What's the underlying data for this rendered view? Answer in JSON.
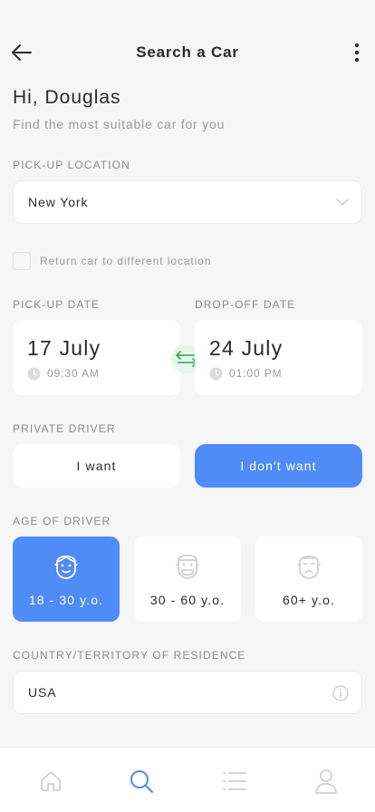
{
  "header": {
    "title": "Search a Car",
    "back_icon": "arrow-left-icon",
    "more_icon": "more-vertical-icon"
  },
  "greeting": {
    "title": "Hi, Douglas",
    "subtitle": "Find the most suitable car for you"
  },
  "pickup_location": {
    "label": "PICK-UP LOCATION",
    "value": "New York",
    "icon": "chevron-down-icon"
  },
  "return_different": {
    "label": "Return car to different location",
    "checked": false
  },
  "dates": {
    "pickup": {
      "label": "PICK-UP DATE",
      "date": "17 July",
      "time": "09:30 AM"
    },
    "dropoff": {
      "label": "DROP-OFF DATE",
      "date": "24 July",
      "time": "01:00 PM"
    },
    "swap_icon": "swap-arrows-icon"
  },
  "private_driver": {
    "label": "PRIVATE DRIVER",
    "options": [
      "I want",
      "I don't want"
    ],
    "selected": "I don't want"
  },
  "driver_age": {
    "label": "AGE OF DRIVER",
    "options": [
      "18 - 30 y.o.",
      "30 - 60 y.o.",
      "60+ y.o."
    ],
    "selected": "18 - 30 y.o."
  },
  "residence": {
    "label": "COUNTRY/TERRITORY OF RESIDENCE",
    "value": "USA",
    "icon": "info-icon"
  },
  "bottom_nav": {
    "items": [
      "home-icon",
      "search-icon",
      "list-icon",
      "profile-icon"
    ],
    "active": "search-icon"
  },
  "colors": {
    "accent": "#4f8cf7",
    "swap_green": "#3cb65c",
    "background": "#f6f6f6"
  }
}
